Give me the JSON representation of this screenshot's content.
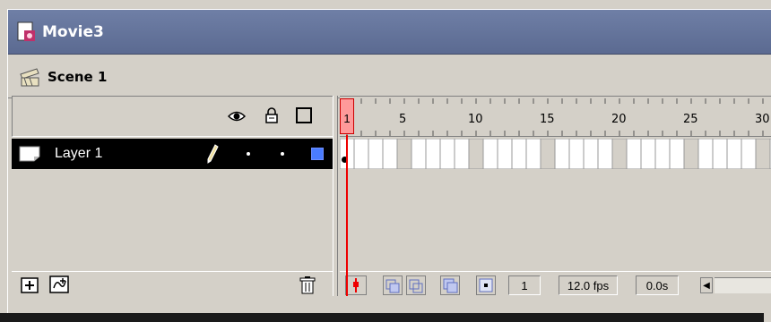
{
  "window": {
    "title": "Movie3",
    "scene": "Scene 1"
  },
  "layers": [
    {
      "name": "Layer 1",
      "color": "#4a7cff",
      "selected": true
    }
  ],
  "timeline": {
    "ruler_labels": [
      "1",
      "5",
      "10",
      "15",
      "20",
      "25",
      "30"
    ],
    "current_frame": "1",
    "frame_rate": "12.0 fps",
    "elapsed_time": "0.0s"
  },
  "icons": {
    "eye": "eye-icon",
    "lock": "lock-icon",
    "outline": "outline-icon",
    "pencil": "pencil-icon",
    "insert_layer": "insert-layer-icon",
    "add_guide": "add-guide-layer-icon",
    "trash": "trash-icon"
  }
}
